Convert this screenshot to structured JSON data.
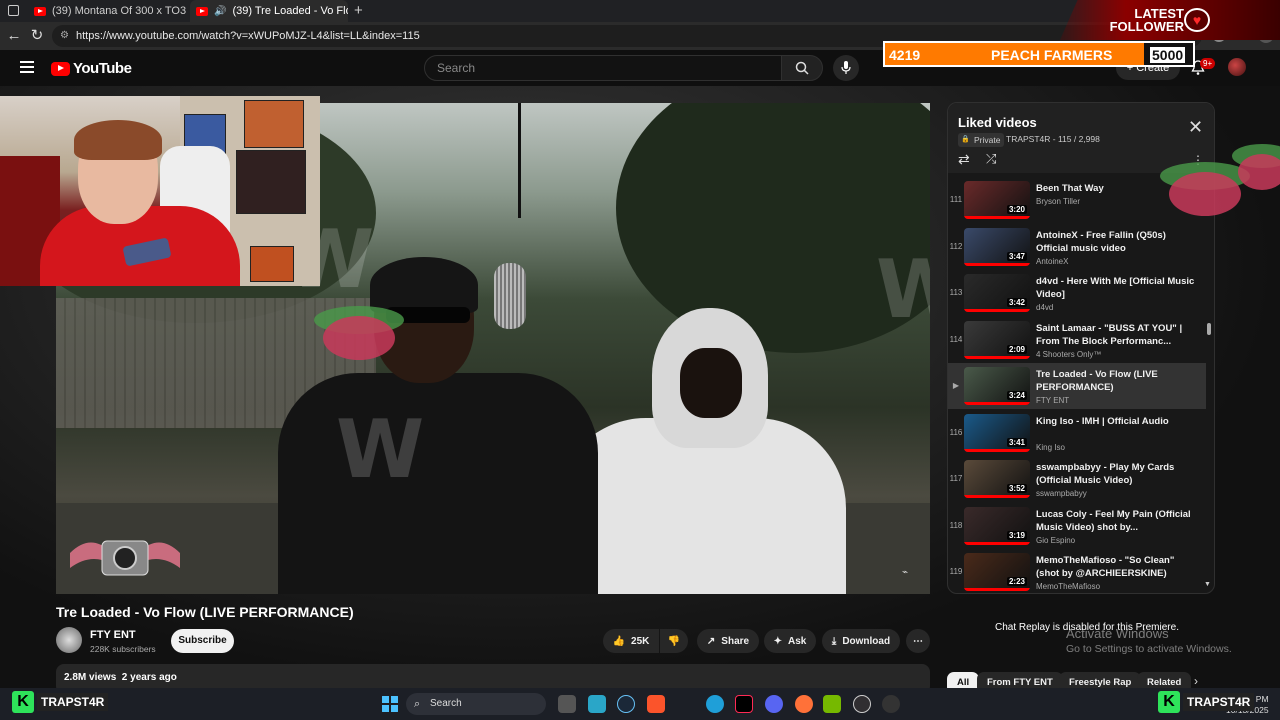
{
  "browser": {
    "tabs": [
      {
        "title": "(39) Montana Of 300 x TO3 x $av",
        "active": false
      },
      {
        "title": "(39) Tre Loaded - Vo Flow (L",
        "active": true
      }
    ],
    "new_tab": "+",
    "url": "https://www.youtube.com/watch?v=xWUPoMJZ-L4&list=LL&index=115"
  },
  "overlay": {
    "latest_follower_label": "LATEST FOLLOWER",
    "goal_current": "4219",
    "goal_name": "PEACH FARMERS",
    "goal_target": "5000",
    "goal_fraction": 0.84,
    "watermark": "W"
  },
  "header": {
    "logo_text": "YouTube",
    "search_placeholder": "Search",
    "create_label": "Create",
    "notif_count": "9+"
  },
  "video": {
    "title": "Tre Loaded - Vo Flow (LIVE PERFORMANCE)",
    "channel": "FTY ENT",
    "subscribers": "228K subscribers",
    "subscribe_label": "Subscribe",
    "likes": "25K",
    "share_label": "Share",
    "ask_label": "Ask",
    "download_label": "Download",
    "views_line": "2.8M views  2 years ago"
  },
  "playlist": {
    "title": "Liked videos",
    "privacy": "Private",
    "owner_progress": "TRAPST4R - 115 / 2,998",
    "items": [
      {
        "index": "111",
        "title": "Been That Way",
        "channel": "Bryson Tiller",
        "duration": "3:20",
        "current": false
      },
      {
        "index": "112",
        "title": "AntoineX - Free Fallin (Q50s) Official music video",
        "channel": "AntoineX",
        "duration": "3:47",
        "current": false
      },
      {
        "index": "113",
        "title": "d4vd - Here With Me [Official Music Video]",
        "channel": "d4vd",
        "duration": "3:42",
        "current": false
      },
      {
        "index": "114",
        "title": "Saint Lamaar - \"BUSS AT YOU\" | From The Block Performanc...",
        "channel": "4 Shooters Only™",
        "duration": "2:09",
        "current": false
      },
      {
        "index": "▶",
        "title": "Tre Loaded - Vo Flow (LIVE PERFORMANCE)",
        "channel": "FTY ENT",
        "duration": "3:24",
        "current": true
      },
      {
        "index": "116",
        "title": "King Iso - IMH | Official Audio",
        "channel": "King Iso",
        "duration": "3:41",
        "current": false
      },
      {
        "index": "117",
        "title": "sswampbabyy - Play My Cards (Official Music Video)",
        "channel": "sswampbabyy",
        "duration": "3:52",
        "current": false
      },
      {
        "index": "118",
        "title": "Lucas Coly - Feel My Pain (Official Music Video) shot by...",
        "channel": "Gio Espino",
        "duration": "3:19",
        "current": false
      },
      {
        "index": "119",
        "title": "MemoTheMafioso - \"So Clean\" (shot by @ARCHIEERSKINE)",
        "channel": "MemoTheMafioso",
        "duration": "2:23",
        "current": false
      }
    ]
  },
  "sidebar_below": {
    "chat_replay": "Chat Replay is disabled for this Premiere.",
    "activate_title": "Activate Windows",
    "activate_sub": "Go to Settings to activate Windows.",
    "chips": [
      "All",
      "From FTY ENT",
      "Freestyle Rap",
      "Related"
    ]
  },
  "taskbar": {
    "search_placeholder": "Search",
    "clock_time": "3:41 PM",
    "clock_date": "10/13/2025",
    "brand": "TRAPST4R",
    "brand_k": "K"
  }
}
